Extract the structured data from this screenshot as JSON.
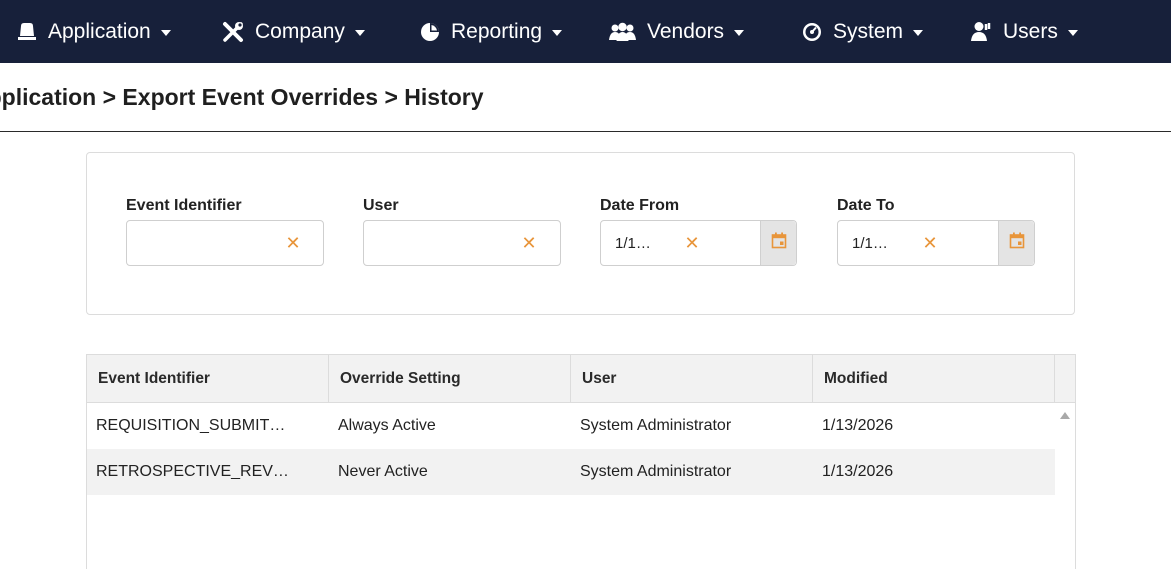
{
  "nav": {
    "items": [
      {
        "label": "Application",
        "icon": "bell-icon"
      },
      {
        "label": "Company",
        "icon": "tools-icon"
      },
      {
        "label": "Reporting",
        "icon": "pie-chart-icon"
      },
      {
        "label": "Vendors",
        "icon": "users-group-icon"
      },
      {
        "label": "System",
        "icon": "gauge-icon"
      },
      {
        "label": "Users",
        "icon": "user-icon"
      }
    ]
  },
  "breadcrumb": "Application > Export Event Overrides > History",
  "filters": {
    "event_identifier": {
      "label": "Event Identifier",
      "value": ""
    },
    "user": {
      "label": "User",
      "value": ""
    },
    "date_from": {
      "label": "Date From",
      "value": "1/1…"
    },
    "date_to": {
      "label": "Date To",
      "value": "1/1…"
    }
  },
  "grid": {
    "columns": [
      "Event Identifier",
      "Override Setting",
      "User",
      "Modified"
    ],
    "rows": [
      [
        "REQUISITION_SUBMIT…",
        "Always Active",
        "System Administrator",
        "1/13/2026"
      ],
      [
        "RETROSPECTIVE_REV…",
        "Never Active",
        "System Administrator",
        "1/13/2026"
      ]
    ]
  },
  "colors": {
    "nav_bg": "#17203a",
    "accent_orange": "#e8953a",
    "row_alt": "#f2f2f2"
  }
}
